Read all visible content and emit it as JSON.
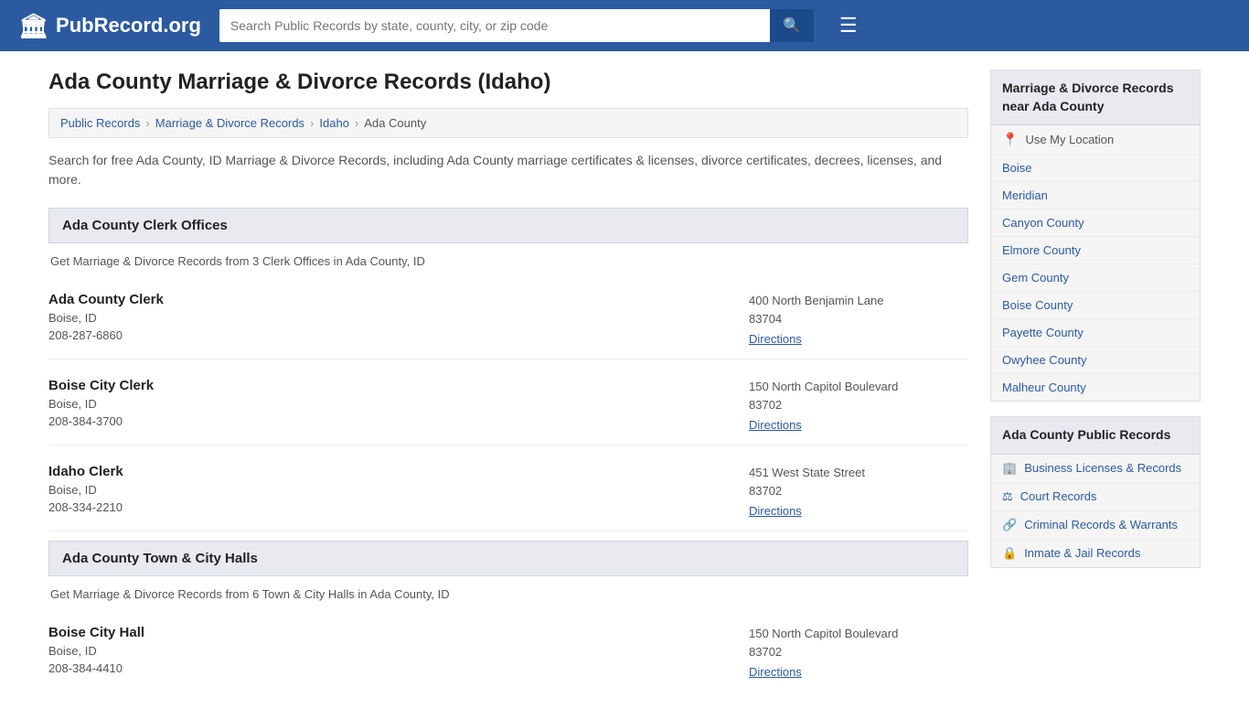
{
  "header": {
    "logo_icon": "🏛",
    "logo_text": "PubRecord.org",
    "search_placeholder": "Search Public Records by state, county, city, or zip code",
    "search_btn_icon": "🔍",
    "menu_icon": "☰"
  },
  "page": {
    "title": "Ada County Marriage & Divorce Records (Idaho)",
    "description": "Search for free Ada County, ID Marriage & Divorce Records, including Ada County marriage certificates & licenses, divorce certificates, decrees, licenses, and more."
  },
  "breadcrumb": {
    "items": [
      {
        "label": "Public Records",
        "href": "#"
      },
      {
        "label": "Marriage & Divorce Records",
        "href": "#"
      },
      {
        "label": "Idaho",
        "href": "#"
      },
      {
        "label": "Ada County",
        "href": "#"
      }
    ],
    "separators": [
      ">",
      ">",
      ">"
    ]
  },
  "clerk_section": {
    "header": "Ada County Clerk Offices",
    "description": "Get Marriage & Divorce Records from 3 Clerk Offices in Ada County, ID",
    "entries": [
      {
        "name": "Ada County Clerk",
        "city": "Boise, ID",
        "phone": "208-287-6860",
        "address": "400 North Benjamin Lane",
        "zip": "83704",
        "directions_label": "Directions"
      },
      {
        "name": "Boise City Clerk",
        "city": "Boise, ID",
        "phone": "208-384-3700",
        "address": "150 North Capitol Boulevard",
        "zip": "83702",
        "directions_label": "Directions"
      },
      {
        "name": "Idaho Clerk",
        "city": "Boise, ID",
        "phone": "208-334-2210",
        "address": "451 West State Street",
        "zip": "83702",
        "directions_label": "Directions"
      }
    ]
  },
  "cityhall_section": {
    "header": "Ada County Town & City Halls",
    "description": "Get Marriage & Divorce Records from 6 Town & City Halls in Ada County, ID",
    "entries": [
      {
        "name": "Boise City Hall",
        "city": "Boise, ID",
        "phone": "208-384-4410",
        "address": "150 North Capitol Boulevard",
        "zip": "83702",
        "directions_label": "Directions"
      }
    ]
  },
  "sidebar": {
    "nearby_section": {
      "title": "Marriage & Divorce Records near Ada County",
      "items": [
        {
          "label": "Use My Location",
          "icon": "📍",
          "is_location": true
        },
        {
          "label": "Boise",
          "icon": ""
        },
        {
          "label": "Meridian",
          "icon": ""
        },
        {
          "label": "Canyon County",
          "icon": ""
        },
        {
          "label": "Elmore County",
          "icon": ""
        },
        {
          "label": "Gem County",
          "icon": ""
        },
        {
          "label": "Boise County",
          "icon": ""
        },
        {
          "label": "Payette County",
          "icon": ""
        },
        {
          "label": "Owyhee County",
          "icon": ""
        },
        {
          "label": "Malheur County",
          "icon": ""
        }
      ]
    },
    "public_records_section": {
      "title": "Ada County Public Records",
      "items": [
        {
          "label": "Business Licenses & Records",
          "icon": "🏢"
        },
        {
          "label": "Court Records",
          "icon": "⚖"
        },
        {
          "label": "Criminal Records & Warrants",
          "icon": "🔗"
        },
        {
          "label": "Inmate & Jail Records",
          "icon": "🔒"
        }
      ]
    }
  }
}
